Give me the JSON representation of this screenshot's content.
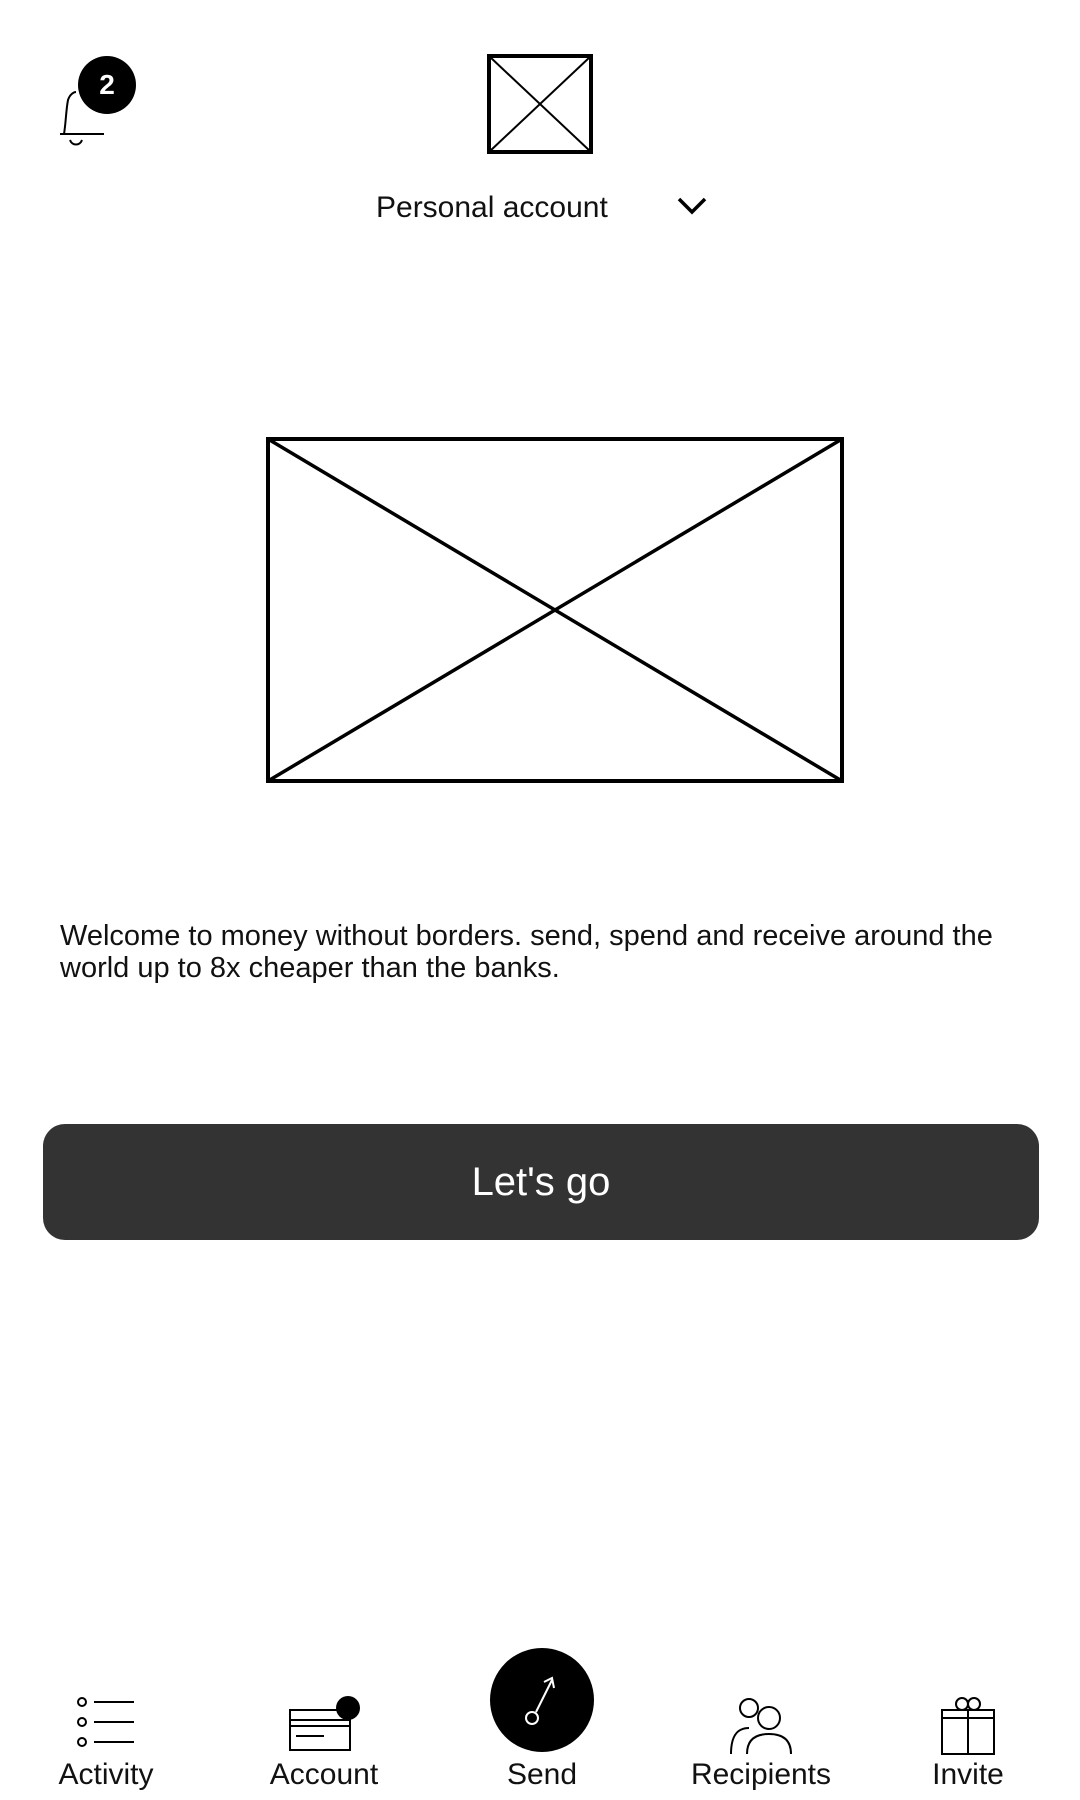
{
  "header": {
    "notification_count": "2",
    "account_label": "Personal account"
  },
  "main": {
    "welcome_text": "Welcome to money without borders. send, spend and receive around the world up to 8x cheaper than the banks.",
    "cta_label": "Let's go"
  },
  "nav": {
    "items": [
      {
        "label": "Activity",
        "icon": "list-icon"
      },
      {
        "label": "Account",
        "icon": "card-icon"
      },
      {
        "label": "Send",
        "icon": "send-arrow-icon"
      },
      {
        "label": "Recipients",
        "icon": "people-icon"
      },
      {
        "label": "Invite",
        "icon": "gift-icon"
      }
    ]
  },
  "colors": {
    "button_bg": "#333333",
    "badge_bg": "#000000"
  }
}
